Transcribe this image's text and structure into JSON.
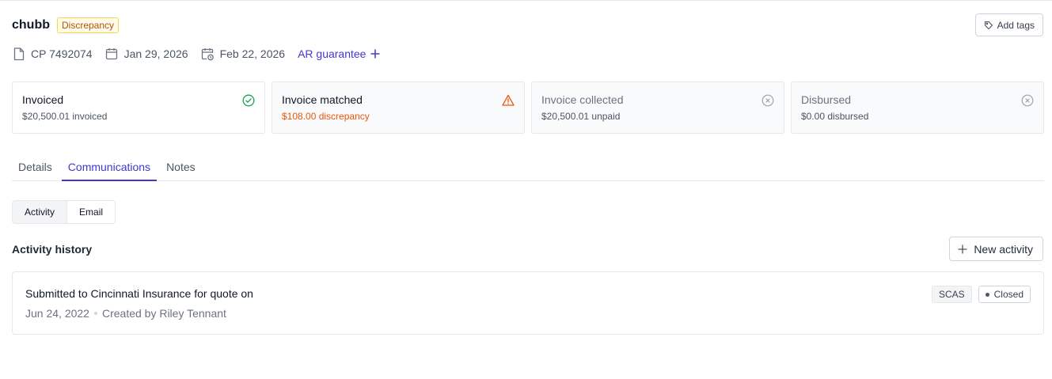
{
  "header": {
    "company": "chubb",
    "status_badge": "Discrepancy",
    "add_tags_label": "Add tags"
  },
  "meta": {
    "policy": "CP 7492074",
    "start_date": "Jan 29, 2026",
    "due_date": "Feb 22, 2026",
    "ar_guarantee_label": "AR guarantee"
  },
  "cards": [
    {
      "title": "Invoiced",
      "subtitle": "$20,500.01 invoiced",
      "state": "complete",
      "icon": "check-circle-icon",
      "color": "#16a34a"
    },
    {
      "title": "Invoice matched",
      "subtitle": "$108.00 discrepancy",
      "state": "warning",
      "icon": "warning-triangle-icon",
      "color": "#ea580c"
    },
    {
      "title": "Invoice collected",
      "subtitle": "$20,500.01 unpaid",
      "state": "pending",
      "icon": "x-circle-icon",
      "color": "#9ca3af"
    },
    {
      "title": "Disbursed",
      "subtitle": "$0.00 disbursed",
      "state": "pending",
      "icon": "x-circle-icon",
      "color": "#9ca3af"
    }
  ],
  "tabs": [
    {
      "label": "Details",
      "active": false
    },
    {
      "label": "Communications",
      "active": true
    },
    {
      "label": "Notes",
      "active": false
    }
  ],
  "segments": [
    {
      "label": "Activity",
      "active": true
    },
    {
      "label": "Email",
      "active": false
    }
  ],
  "activity": {
    "section_title": "Activity history",
    "new_activity_label": "New activity",
    "items": [
      {
        "title": "Submitted to Cincinnati Insurance for quote on",
        "date": "Jun 24, 2022",
        "created_by": "Created by Riley Tennant",
        "tag": "SCAS",
        "status": "Closed"
      }
    ]
  },
  "colors": {
    "accent": "#4338ca",
    "warning": "#ea580c",
    "success": "#16a34a"
  }
}
